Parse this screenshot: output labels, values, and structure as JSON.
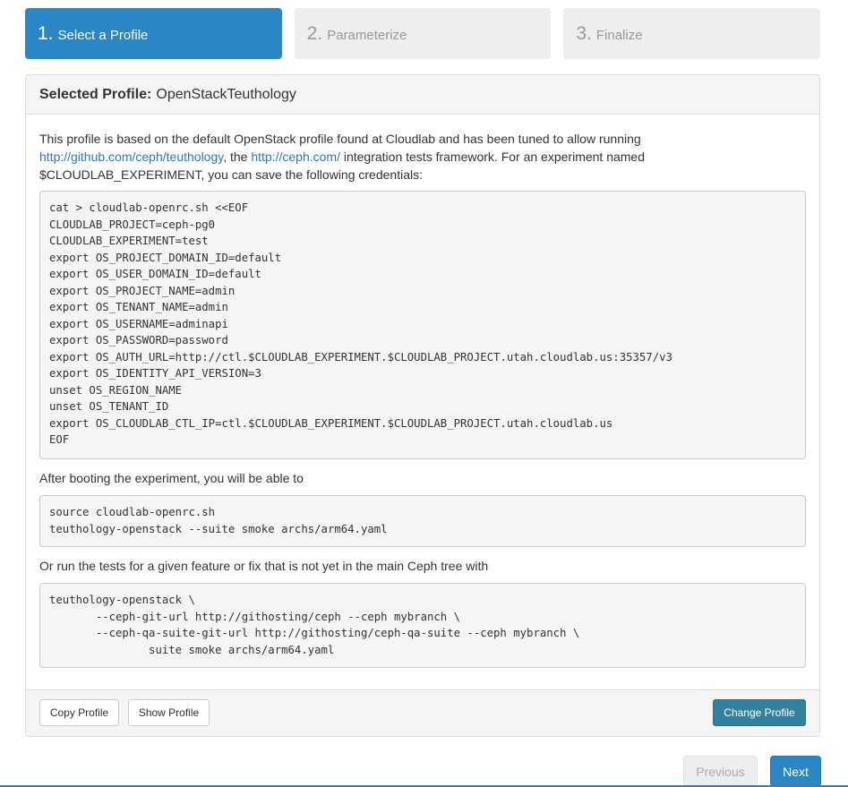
{
  "wizard": {
    "steps": [
      {
        "num": "1.",
        "label": "Select a Profile"
      },
      {
        "num": "2.",
        "label": "Parameterize"
      },
      {
        "num": "3.",
        "label": "Finalize"
      }
    ]
  },
  "panel": {
    "heading_label": "Selected Profile:",
    "profile_name": "OpenStackTeuthology",
    "intro": {
      "text1": "This profile is based on the default OpenStack profile found at Cloudlab and has been tuned to allow running ",
      "link1": "http://github.com/ceph/teuthology",
      "text2": ", the ",
      "link2": "http://ceph.com/",
      "text3": " integration tests framework. For an experiment named $CLOUDLAB_EXPERIMENT, you can save the following credentials:"
    },
    "code1": "cat > cloudlab-openrc.sh <<EOF\nCLOUDLAB_PROJECT=ceph-pg0\nCLOUDLAB_EXPERIMENT=test\nexport OS_PROJECT_DOMAIN_ID=default\nexport OS_USER_DOMAIN_ID=default\nexport OS_PROJECT_NAME=admin\nexport OS_TENANT_NAME=admin\nexport OS_USERNAME=adminapi\nexport OS_PASSWORD=password\nexport OS_AUTH_URL=http://ctl.$CLOUDLAB_EXPERIMENT.$CLOUDLAB_PROJECT.utah.cloudlab.us:35357/v3\nexport OS_IDENTITY_API_VERSION=3\nunset OS_REGION_NAME\nunset OS_TENANT_ID\nexport OS_CLOUDLAB_CTL_IP=ctl.$CLOUDLAB_EXPERIMENT.$CLOUDLAB_PROJECT.utah.cloudlab.us\nEOF",
    "para2": "After booting the experiment, you will be able to",
    "code2": "source cloudlab-openrc.sh\nteuthology-openstack --suite smoke archs/arm64.yaml",
    "para3": "Or run the tests for a given feature or fix that is not yet in the main Ceph tree with",
    "code3": "teuthology-openstack \\\n       --ceph-git-url http://githosting/ceph --ceph mybranch \\\n       --ceph-qa-suite-git-url http://githosting/ceph-qa-suite --ceph mybranch \\\n               suite smoke archs/arm64.yaml"
  },
  "footer": {
    "copy_label": "Copy Profile",
    "show_label": "Show Profile",
    "change_label": "Change Profile"
  },
  "nav": {
    "previous_label": "Previous",
    "next_label": "Next"
  },
  "colors": {
    "accent": "#2a86c4",
    "info_button": "#31819f",
    "link": "#2a7ab8"
  }
}
